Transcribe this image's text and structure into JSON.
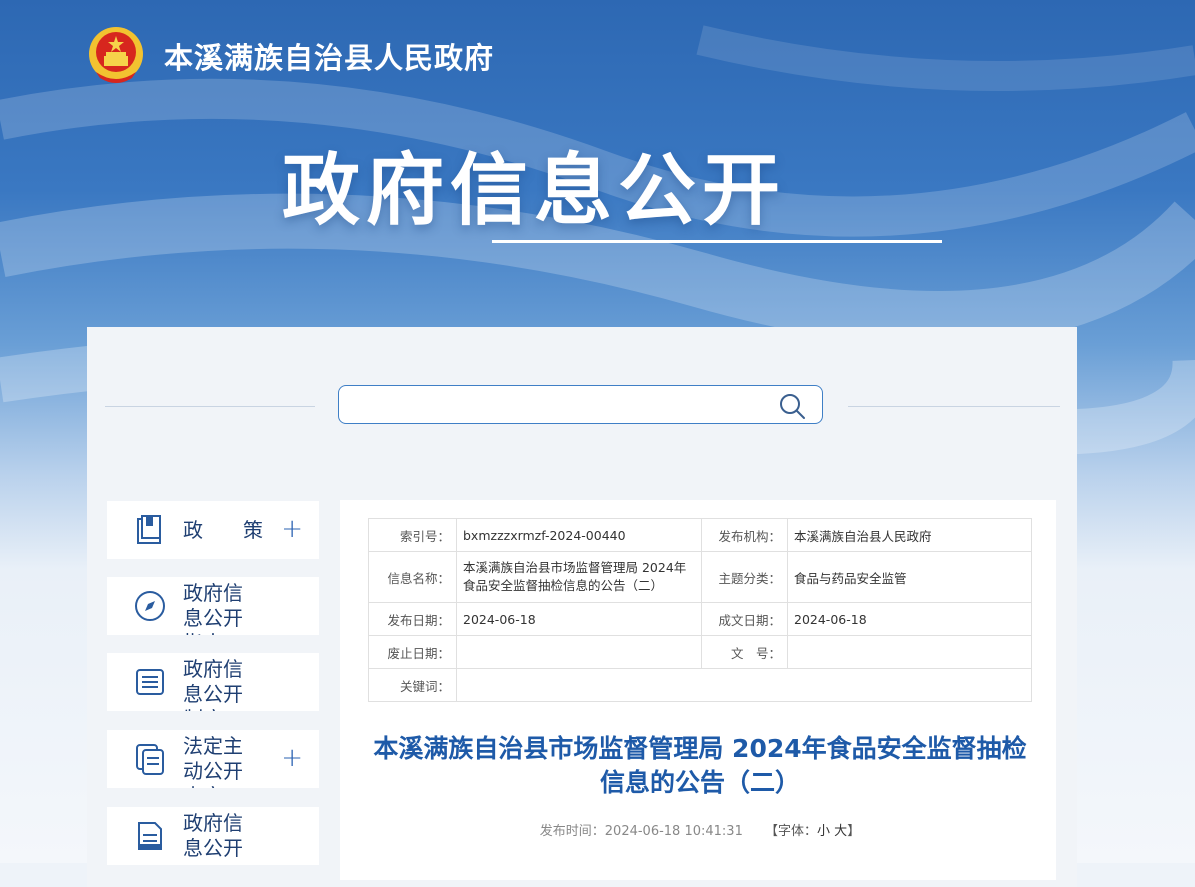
{
  "site": {
    "title": "本溪满族自治县人民政府"
  },
  "hero": {
    "title": "政府信息公开"
  },
  "search": {
    "placeholder": ""
  },
  "nav": [
    {
      "label": "政　　策",
      "has_plus": true,
      "icon": "book-icon"
    },
    {
      "label": "政府信息公开指南",
      "has_plus": false,
      "icon": "compass-icon"
    },
    {
      "label": "政府信息公开制度",
      "has_plus": false,
      "icon": "document-list-icon"
    },
    {
      "label": "法定主动公开内容",
      "has_plus": true,
      "icon": "copy-icon"
    },
    {
      "label": "政府信息公开",
      "has_plus": false,
      "icon": "edit-document-icon"
    }
  ],
  "meta": {
    "index_label": "索引号：",
    "index_value": "bxmzzzxrmzf-2024-00440",
    "org_label": "发布机构：",
    "org_value": "本溪满族自治县人民政府",
    "name_label": "信息名称：",
    "name_value": "本溪满族自治县市场监督管理局 2024年食品安全监督抽检信息的公告（二）",
    "topic_label": "主题分类：",
    "topic_value": "食品与药品安全监管",
    "pub_date_label": "发布日期：",
    "pub_date_value": "2024-06-18",
    "made_date_label": "成文日期：",
    "made_date_value": "2024-06-18",
    "expire_label": "废止日期：",
    "expire_value": "",
    "doc_no_label": "文　号：",
    "doc_no_value": "",
    "keywords_label": "关键词：",
    "keywords_value": ""
  },
  "article": {
    "title": "本溪满族自治县市场监督管理局 2024年食品安全监督抽检信息的公告（二）",
    "publish_time": "发布时间：2024-06-18 10:41:31",
    "font_prefix": "【字体：",
    "font_small": "小",
    "font_large": "大",
    "font_suffix": "】"
  },
  "colors": {
    "accent": "#1e5aa8",
    "header_blue": "#2d68b3"
  }
}
